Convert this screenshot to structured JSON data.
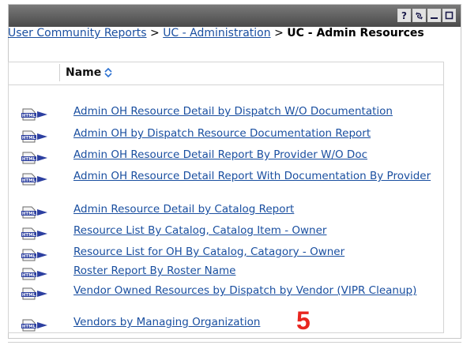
{
  "window": {
    "buttons": [
      {
        "label": "?"
      },
      {
        "label": "refresh"
      },
      {
        "label": "minimize"
      },
      {
        "label": "maximize"
      }
    ]
  },
  "breadcrumb": {
    "items": [
      "User Community Reports",
      "UC - Administration"
    ],
    "separator": ">",
    "current": "UC - Admin Resources"
  },
  "table": {
    "column_header": "Name",
    "rows": [
      {
        "icon_text": "HTML",
        "name": "Admin OH Resource Detail by Dispatch W/O Documentation"
      },
      {
        "icon_text": "HTML",
        "name": "Admin OH by Dispatch Resource Documentation Report"
      },
      {
        "icon_text": "HTML",
        "name": "Admin OH Resource Detail Report By Provider W/O Doc"
      },
      {
        "icon_text": "HTML",
        "name": "Admin OH Resource Detail Report With Documentation By Provider"
      },
      {
        "icon_text": "HTML",
        "name": "Admin Resource Detail by Catalog Report"
      },
      {
        "icon_text": "HTML",
        "name": "Resource List By Catalog, Catalog Item - Owner"
      },
      {
        "icon_text": "HTML",
        "name": "Resource List for OH By Catalog, Catagory - Owner"
      },
      {
        "icon_text": "HTML",
        "name": "Roster Report By Roster Name"
      },
      {
        "icon_text": "HTML",
        "name": "Vendor Owned Resources by Dispatch by Vendor (VIPR Cleanup)"
      },
      {
        "icon_text": "HTML",
        "name": "Vendors by Managing Organization"
      }
    ]
  },
  "annotation": {
    "label": "5",
    "color": "#e8261f"
  },
  "colors": {
    "link": "#1a4fa0",
    "titlebar": "#5a5a5a"
  }
}
